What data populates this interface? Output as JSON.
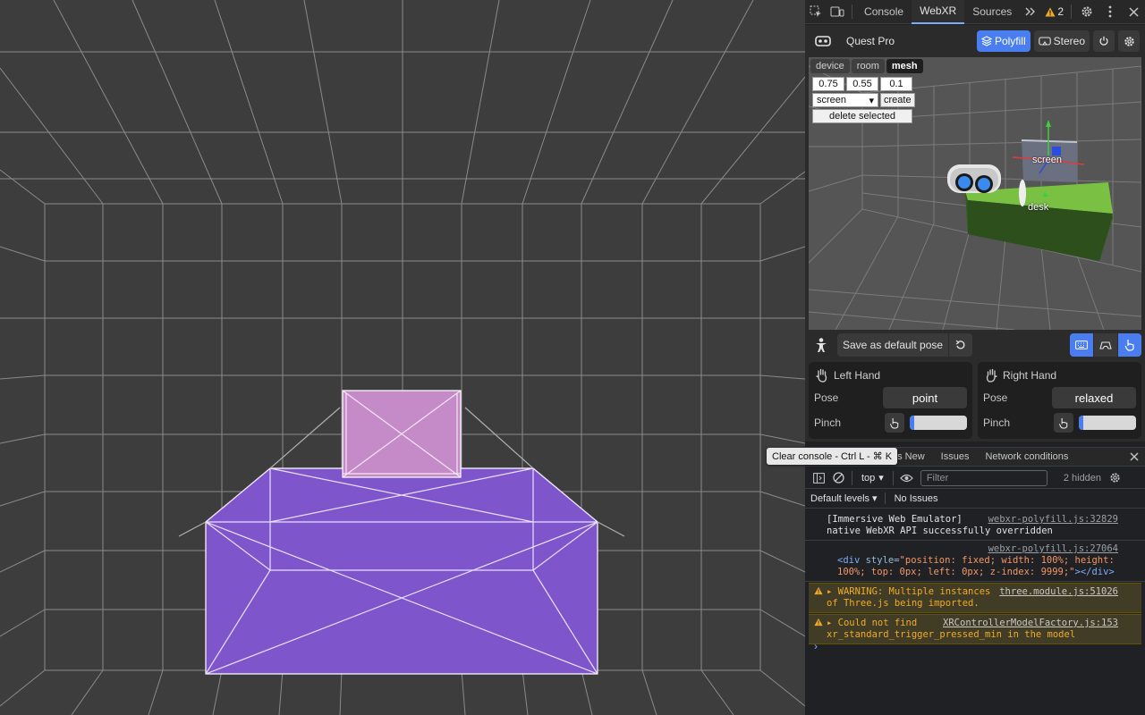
{
  "devtools": {
    "tabs": [
      "Console",
      "WebXR",
      "Sources"
    ],
    "active_tab": "WebXR",
    "warning_count": "2"
  },
  "webxr": {
    "device_name": "Quest Pro",
    "polyfill_label": "Polyfill",
    "stereo_label": "Stereo",
    "scene_tabs": [
      "device",
      "room",
      "mesh"
    ],
    "active_scene_tab": "mesh",
    "mesh_inputs": [
      "0.75",
      "0.55",
      "0.1"
    ],
    "mesh_select": "screen",
    "create_label": "create",
    "delete_label": "delete selected",
    "scene_labels": {
      "screen": "screen",
      "desk": "desk"
    },
    "save_pose_label": "Save as default pose",
    "left_hand": {
      "title": "Left Hand",
      "pose_label": "Pose",
      "pose_value": "point",
      "pinch_label": "Pinch",
      "pinch_level": 0.08
    },
    "right_hand": {
      "title": "Right Hand",
      "pose_label": "Pose",
      "pose_value": "relaxed",
      "pinch_label": "Pinch",
      "pinch_level": 0.08
    }
  },
  "drawer": {
    "tooltip": "Clear console - Ctrl L - ⌘ K",
    "tabs": [
      "'s New",
      "Issues",
      "Network conditions"
    ],
    "context": "top",
    "filter_placeholder": "Filter",
    "hidden_count": "2 hidden",
    "levels_label": "Default levels",
    "no_issues": "No Issues"
  },
  "console": {
    "msg1_text": "[Immersive Web Emulator] native WebXR API successfully overridden",
    "msg1_src": "webxr-polyfill.js:32829",
    "msg2_src": "webxr-polyfill.js:27064",
    "msg2_tag_open": "<div ",
    "msg2_attr": "style=",
    "msg2_val": "\"position: fixed; width: 100%; height: 100%; top: 0px; left: 0px; z-index: 9999;\"",
    "msg2_tag_close": "></div>",
    "msg3_text": "WARNING: Multiple instances of Three.js being imported.",
    "msg3_src": "three.module.js:51026",
    "msg4_text": "Could not find xr_standard_trigger_pressed_min in the model",
    "msg4_src": "XRControllerModelFactory.js:153"
  },
  "colors": {
    "accent": "#4a7df0",
    "mesh_fill": "#7f55cc",
    "screen_mesh_fill": "#c58bc8",
    "desk_green": "#7ac143"
  }
}
